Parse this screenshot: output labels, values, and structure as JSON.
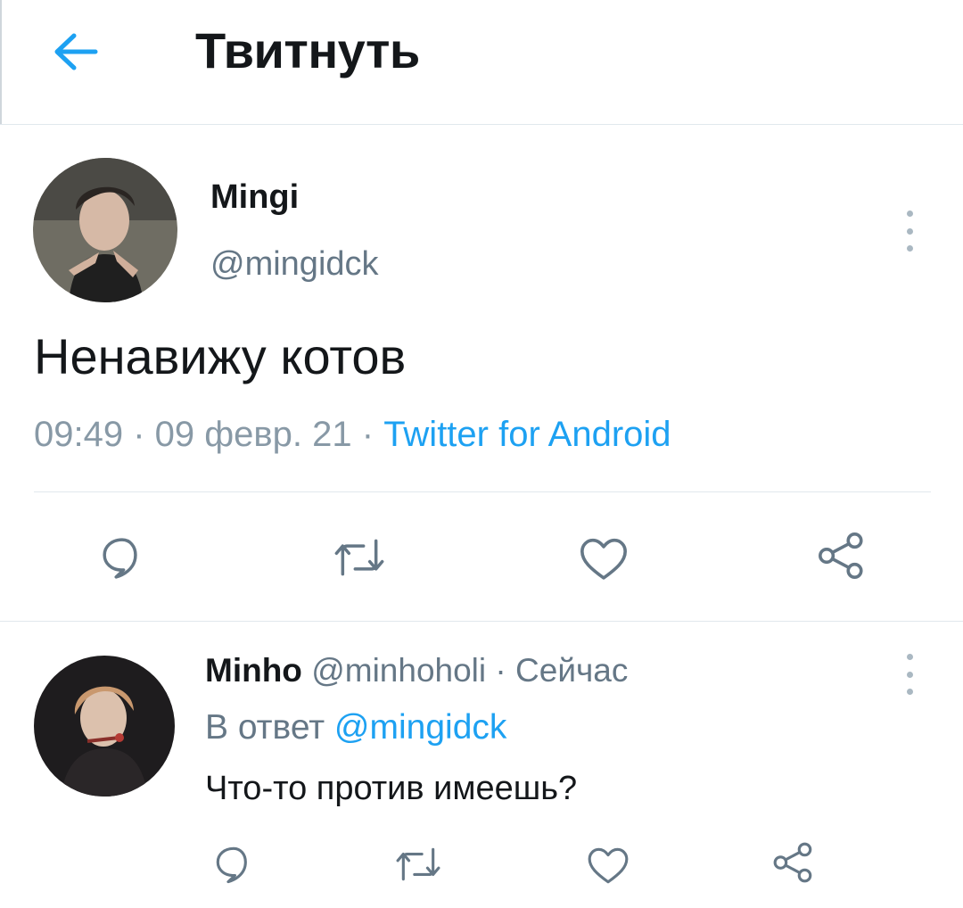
{
  "header": {
    "title": "Твитнуть",
    "back_icon": "arrow-left-icon",
    "accent": "#1da1f2"
  },
  "tweet": {
    "name": "Mingi",
    "handle": "@mingidck",
    "text": "Ненавижу котов",
    "time": "09:49",
    "date": "09 февр. 21",
    "source": "Twitter for Android",
    "sep": " · ",
    "actions": [
      "reply-icon",
      "retweet-icon",
      "like-icon",
      "share-icon"
    ]
  },
  "reply": {
    "name": "Minho",
    "handle": "@minhoholi",
    "time": "Сейчас",
    "sep": " · ",
    "replying_prefix": "В ответ ",
    "replying_to": "@mingidck",
    "text": "Что-то против имеешь?"
  },
  "colors": {
    "text": "#14171a",
    "secondary": "#657786",
    "icon": "#657786",
    "link": "#1da1f2"
  }
}
